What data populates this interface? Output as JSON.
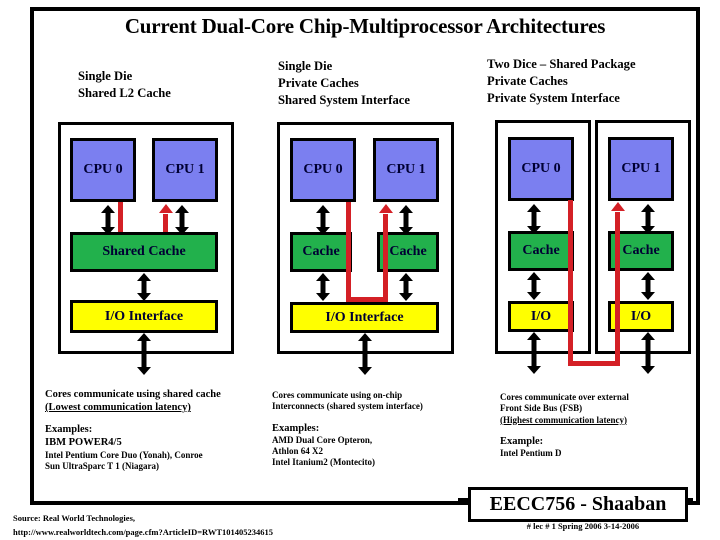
{
  "slide": {
    "title": "Current Dual-Core Chip-Multiprocessor Architectures",
    "headers": [
      "Single Die\nShared L2 Cache",
      "Single Die\nPrivate Caches\nShared System Interface",
      "Two Dice – Shared Package\nPrivate Caches\nPrivate System Interface"
    ]
  },
  "diagrams": {
    "one": {
      "cpu0": "CPU 0",
      "cpu1": "CPU 1",
      "cache": "Shared Cache",
      "io": "I/O Interface"
    },
    "two": {
      "cpu0": "CPU 0",
      "cpu1": "CPU 1",
      "cache0": "Cache",
      "cache1": "Cache",
      "io": "I/O Interface"
    },
    "three": {
      "cpu0": "CPU 0",
      "cpu1": "CPU 1",
      "cache0": "Cache",
      "cache1": "Cache",
      "io0": "I/O",
      "io1": "I/O"
    }
  },
  "notes": {
    "one": {
      "line1": "Cores communicate using shared cache",
      "line2": "(Lowest communication latency)",
      "examples_label": "Examples:",
      "examples": [
        "IBM POWER4/5",
        "Intel Pentium Core Duo (Yonah), Conroe",
        "Sun UltraSparc T 1  (Niagara)"
      ]
    },
    "two": {
      "line1": "Cores communicate using on-chip",
      "line2": "Interconnects (shared system interface)",
      "examples_label": "Examples:",
      "examples": [
        "AMD  Dual Core Opteron,",
        "        Athlon 64 X2",
        "Intel Itanium2 (Montecito)"
      ]
    },
    "three": {
      "line1": "Cores communicate over external",
      "line2": "Front Side Bus (FSB)",
      "line3": "(Highest communication latency)",
      "examples_label": "Example:",
      "examples": [
        "Intel Pentium D"
      ]
    }
  },
  "footer": {
    "source": "Source: Real World Technologies,",
    "url": "http://www.realworldtech.com/page.cfm?ArticleID=RWT101405234615",
    "badge": "EECC756 - Shaaban",
    "badge_sub": "#  lec # 1    Spring 2006   3-14-2006"
  },
  "colors": {
    "cpu": "#7b7ff0",
    "cache": "#22b14c",
    "io": "#ffff00",
    "connector": "#d42026",
    "border": "#000000"
  }
}
